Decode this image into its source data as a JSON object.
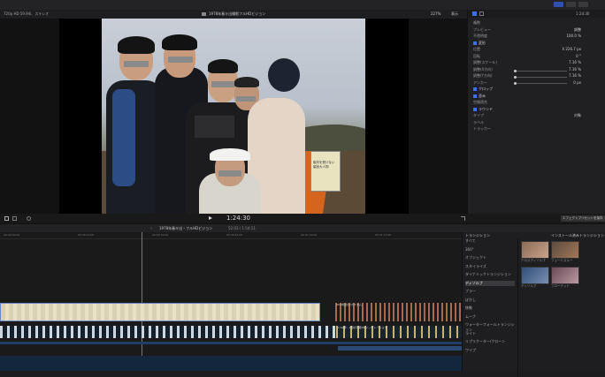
{
  "topbar": {
    "title": "",
    "icons": [
      "layout-icon",
      "layout-icon",
      "layout-icon"
    ]
  },
  "viewer": {
    "format": "720p HD 59.94i、ステレオ",
    "title": "1978年春キ出撮影フルHDビジョン",
    "zoom": "227%",
    "view": "表示",
    "timecode": "1:24:30",
    "sign_text": "取材を受けない\n脇役大人物"
  },
  "inspector": {
    "title": "1:24:30",
    "rows": [
      {
        "label": "複数",
        "value": ""
      },
      {
        "label": "プレビュー",
        "value": "調整"
      },
      {
        "label": "不透明度",
        "value": "100.0 %"
      },
      {
        "label": "変形",
        "value": "",
        "section": true
      },
      {
        "label": "位置",
        "value": "X 226.7 px"
      },
      {
        "label": "回転",
        "value": "0 °"
      },
      {
        "label": "調整(スケール)",
        "value": "7.16 %"
      },
      {
        "label": "調整(X方向)",
        "value": "7.16 %"
      },
      {
        "label": "調整(Y方向)",
        "value": "7.16 %"
      },
      {
        "label": "アンカー",
        "value": "0 px"
      },
      {
        "label": "クロップ",
        "value": "",
        "section": true
      },
      {
        "label": "歪み",
        "value": "",
        "section": true
      },
      {
        "label": "空間適合",
        "value": ""
      },
      {
        "label": "ラウンド",
        "value": "",
        "section": true
      },
      {
        "label": "タイプ",
        "value": "対象"
      },
      {
        "label": "ラベル",
        "value": ""
      },
      {
        "label": "トラッカー",
        "value": ""
      }
    ]
  },
  "transport": {
    "timecode": "1:24:30",
    "save_label": "エフェクトプリセットを保存"
  },
  "timeline_header": {
    "project": "1978年春キ出・フルHDビジョン",
    "duration": "52:03 / 1:54:11"
  },
  "timeline": {
    "ruler": [
      "00:00:00:00",
      "00:00:15:00",
      "00:00:30:00",
      "00:00:45:00",
      "00:01:00:00",
      "00:01:15:00"
    ],
    "clip_top_label": "40.0秒出力/カスタム",
    "clip_mid_label": "1.52秒 - 1部の字幕中心/…/ナレーション"
  },
  "browser": {
    "header_left": "トランジション",
    "header_right": "インストール済みトランジション",
    "categories": [
      "すべて",
      "360°",
      "オブジェクト",
      "スタイライズ",
      "ダイナミックトランジション",
      "ディゾルブ",
      "ブラー",
      "ぼかし",
      "移動",
      "ムーブ",
      "ウォーターフォールトランジション",
      "ライト",
      "リプリケーター/クローン",
      "ワイプ"
    ],
    "selected_category": "ディゾルブ",
    "thumbs": [
      {
        "label": "クロスディゾルブ"
      },
      {
        "label": "フェードスルー"
      },
      {
        "label": "ディゾルブ"
      },
      {
        "label": "フローテッド"
      }
    ]
  }
}
